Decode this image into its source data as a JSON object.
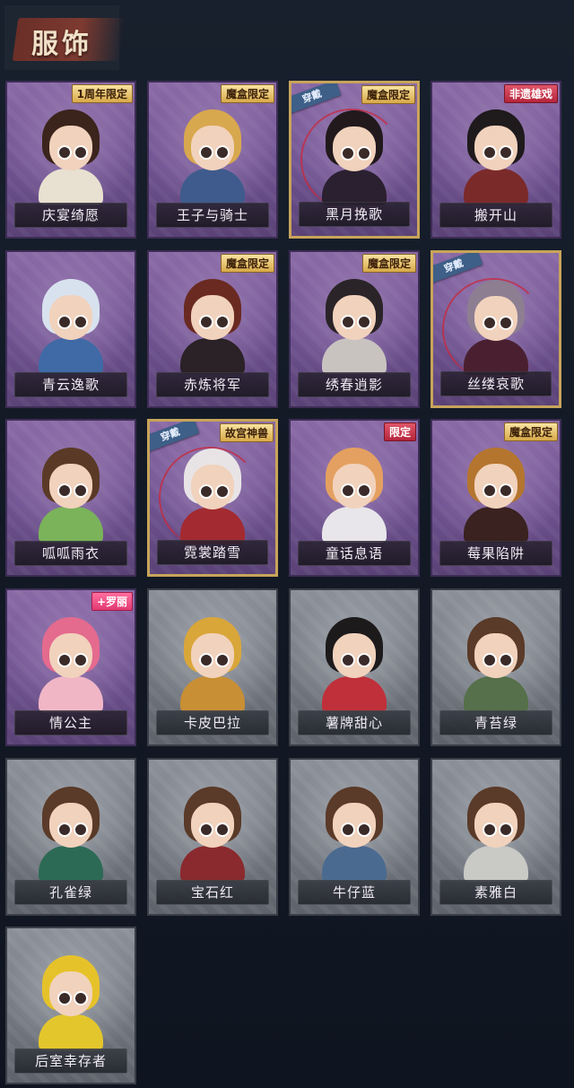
{
  "header": {
    "title": "服饰"
  },
  "items": [
    {
      "name": "庆宴绮愿",
      "badge": "1周年限定",
      "badge_style": "gold",
      "equipped": false,
      "tier": "purple",
      "hair": "#3b241c",
      "body": "#e8e0d0"
    },
    {
      "name": "王子与骑士",
      "badge": "魔盒限定",
      "badge_style": "gold",
      "equipped": false,
      "tier": "purple",
      "hair": "#d8a84e",
      "body": "#3f5b8d"
    },
    {
      "name": "黑月挽歌",
      "badge": "魔盒限定",
      "badge_style": "gold",
      "equipped": true,
      "tier": "purple",
      "hair": "#22191d",
      "body": "#2b2030"
    },
    {
      "name": "搬开山",
      "badge": "非遗雄戏",
      "badge_style": "red",
      "equipped": false,
      "tier": "purple",
      "hair": "#1f1a1c",
      "body": "#7b2a2a"
    },
    {
      "name": "青云逸歌",
      "badge": "",
      "badge_style": "",
      "equipped": false,
      "tier": "purple",
      "hair": "#d8e2ee",
      "body": "#3f6aa6"
    },
    {
      "name": "赤炼将军",
      "badge": "魔盒限定",
      "badge_style": "gold",
      "equipped": false,
      "tier": "purple",
      "hair": "#6a2a22",
      "body": "#2a2226"
    },
    {
      "name": "绣春逍影",
      "badge": "魔盒限定",
      "badge_style": "gold",
      "equipped": false,
      "tier": "purple",
      "hair": "#2a2428",
      "body": "#c9c3c0"
    },
    {
      "name": "丝缕哀歌",
      "badge": "",
      "badge_style": "",
      "equipped": true,
      "tier": "purple",
      "hair": "#8d7e92",
      "body": "#4a2030"
    },
    {
      "name": "呱呱雨衣",
      "badge": "",
      "badge_style": "",
      "equipped": false,
      "tier": "purple",
      "hair": "#5a3a26",
      "body": "#7ab35a"
    },
    {
      "name": "霓裳踏雪",
      "badge": "故宫神兽",
      "badge_style": "gold",
      "equipped": true,
      "tier": "purple",
      "hair": "#e8e4e6",
      "body": "#a32a30"
    },
    {
      "name": "童话息语",
      "badge": "限定",
      "badge_style": "red",
      "equipped": false,
      "tier": "purple",
      "hair": "#e4a060",
      "body": "#e8e6ea"
    },
    {
      "name": "莓果陷阱",
      "badge": "魔盒限定",
      "badge_style": "gold",
      "equipped": false,
      "tier": "purple",
      "hair": "#b4752e",
      "body": "#3a2220"
    },
    {
      "name": "情公主",
      "badge": "+罗丽",
      "badge_style": "pink",
      "equipped": false,
      "tier": "purple",
      "hair": "#e46a8e",
      "body": "#f0b6c6"
    },
    {
      "name": "卡皮巴拉",
      "badge": "",
      "badge_style": "",
      "equipped": false,
      "tier": "gray",
      "hair": "#d9a63a",
      "body": "#c88f34"
    },
    {
      "name": "薯牌甜心",
      "badge": "",
      "badge_style": "",
      "equipped": false,
      "tier": "gray",
      "hair": "#1d1a1c",
      "body": "#c0303a"
    },
    {
      "name": "青苔绿",
      "badge": "",
      "badge_style": "",
      "equipped": false,
      "tier": "gray",
      "hair": "#5a3a28",
      "body": "#55704a"
    },
    {
      "name": "孔雀绿",
      "badge": "",
      "badge_style": "",
      "equipped": false,
      "tier": "gray",
      "hair": "#5a3a28",
      "body": "#2d6a56"
    },
    {
      "name": "宝石红",
      "badge": "",
      "badge_style": "",
      "equipped": false,
      "tier": "gray",
      "hair": "#5a3a28",
      "body": "#8a2a2e"
    },
    {
      "name": "牛仔蓝",
      "badge": "",
      "badge_style": "",
      "equipped": false,
      "tier": "gray",
      "hair": "#5a3a28",
      "body": "#4a6a90"
    },
    {
      "name": "素雅白",
      "badge": "",
      "badge_style": "",
      "equipped": false,
      "tier": "gray",
      "hair": "#5a3a28",
      "body": "#c9c9c6"
    },
    {
      "name": "后室幸存者",
      "badge": "",
      "badge_style": "",
      "equipped": false,
      "tier": "gray",
      "hair": "#e6c22a",
      "body": "#e3c62c"
    }
  ],
  "equipped_tag": "穿戴"
}
